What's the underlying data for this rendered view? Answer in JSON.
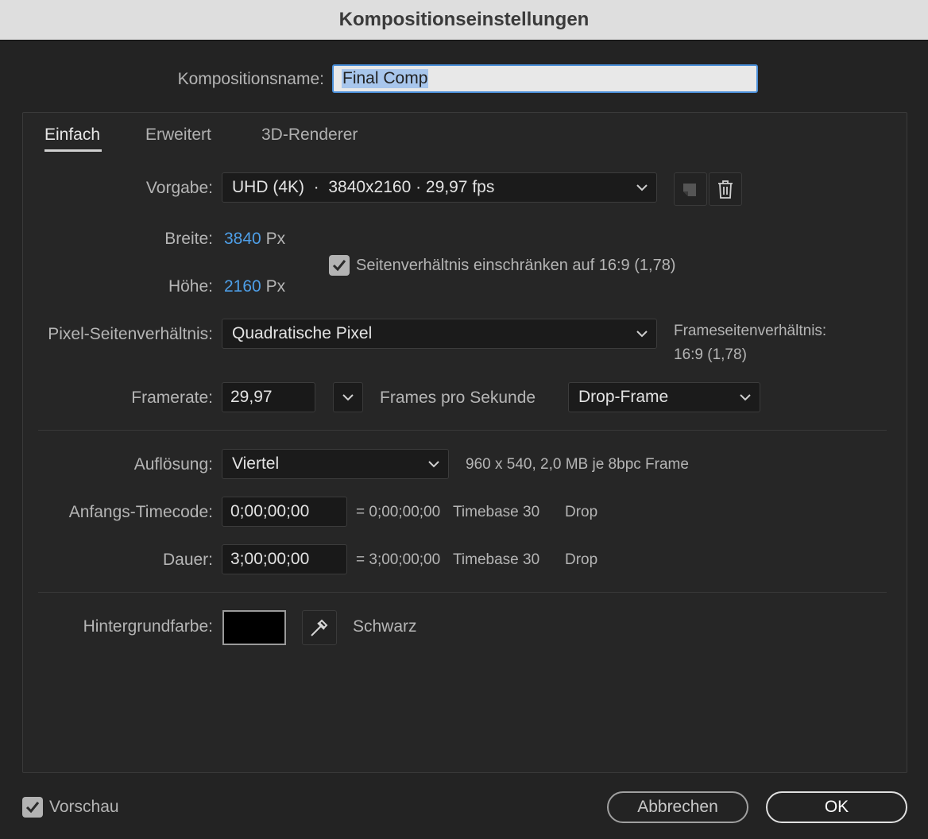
{
  "window": {
    "title": "Kompositionseinstellungen"
  },
  "comp_name": {
    "label": "Kompositionsname:",
    "value": "Final Comp"
  },
  "tabs": [
    {
      "label": "Einfach",
      "active": true
    },
    {
      "label": "Erweitert",
      "active": false
    },
    {
      "label": "3D-Renderer",
      "active": false
    }
  ],
  "preset": {
    "label": "Vorgabe:",
    "value": "UHD (4K)  ·  3840x2160 · 29,97 fps"
  },
  "width": {
    "label": "Breite:",
    "value": "3840",
    "unit": "Px"
  },
  "height": {
    "label": "Höhe:",
    "value": "2160",
    "unit": "Px"
  },
  "aspect_lock": {
    "checked": true,
    "label": "Seitenverhältnis einschränken auf 16:9 (1,78)"
  },
  "pixel_aspect": {
    "label": "Pixel-Seitenverhältnis:",
    "value": "Quadratische Pixel",
    "frame_aspect_label": "Frameseitenverhältnis:",
    "frame_aspect_value": "16:9 (1,78)"
  },
  "framerate": {
    "label": "Framerate:",
    "value": "29,97",
    "unit_label": "Frames pro Sekunde",
    "mode": "Drop-Frame"
  },
  "resolution": {
    "label": "Auflösung:",
    "value": "Viertel",
    "info": "960 x 540, 2,0 MB je 8bpc Frame"
  },
  "start_timecode": {
    "label": "Anfangs-Timecode:",
    "value": "0;00;00;00",
    "equals": "= 0;00;00;00",
    "timebase": "Timebase 30",
    "drop": "Drop"
  },
  "duration": {
    "label": "Dauer:",
    "value": "3;00;00;00",
    "equals": "= 3;00;00;00",
    "timebase": "Timebase 30",
    "drop": "Drop"
  },
  "background": {
    "label": "Hintergrundfarbe:",
    "color": "#000000",
    "name": "Schwarz"
  },
  "preview": {
    "checked": true,
    "label": "Vorschau"
  },
  "buttons": {
    "cancel": "Abbrechen",
    "ok": "OK"
  },
  "colors": {
    "accent_blue": "#4e9fe8",
    "focus_border": "#4a8fd9"
  }
}
